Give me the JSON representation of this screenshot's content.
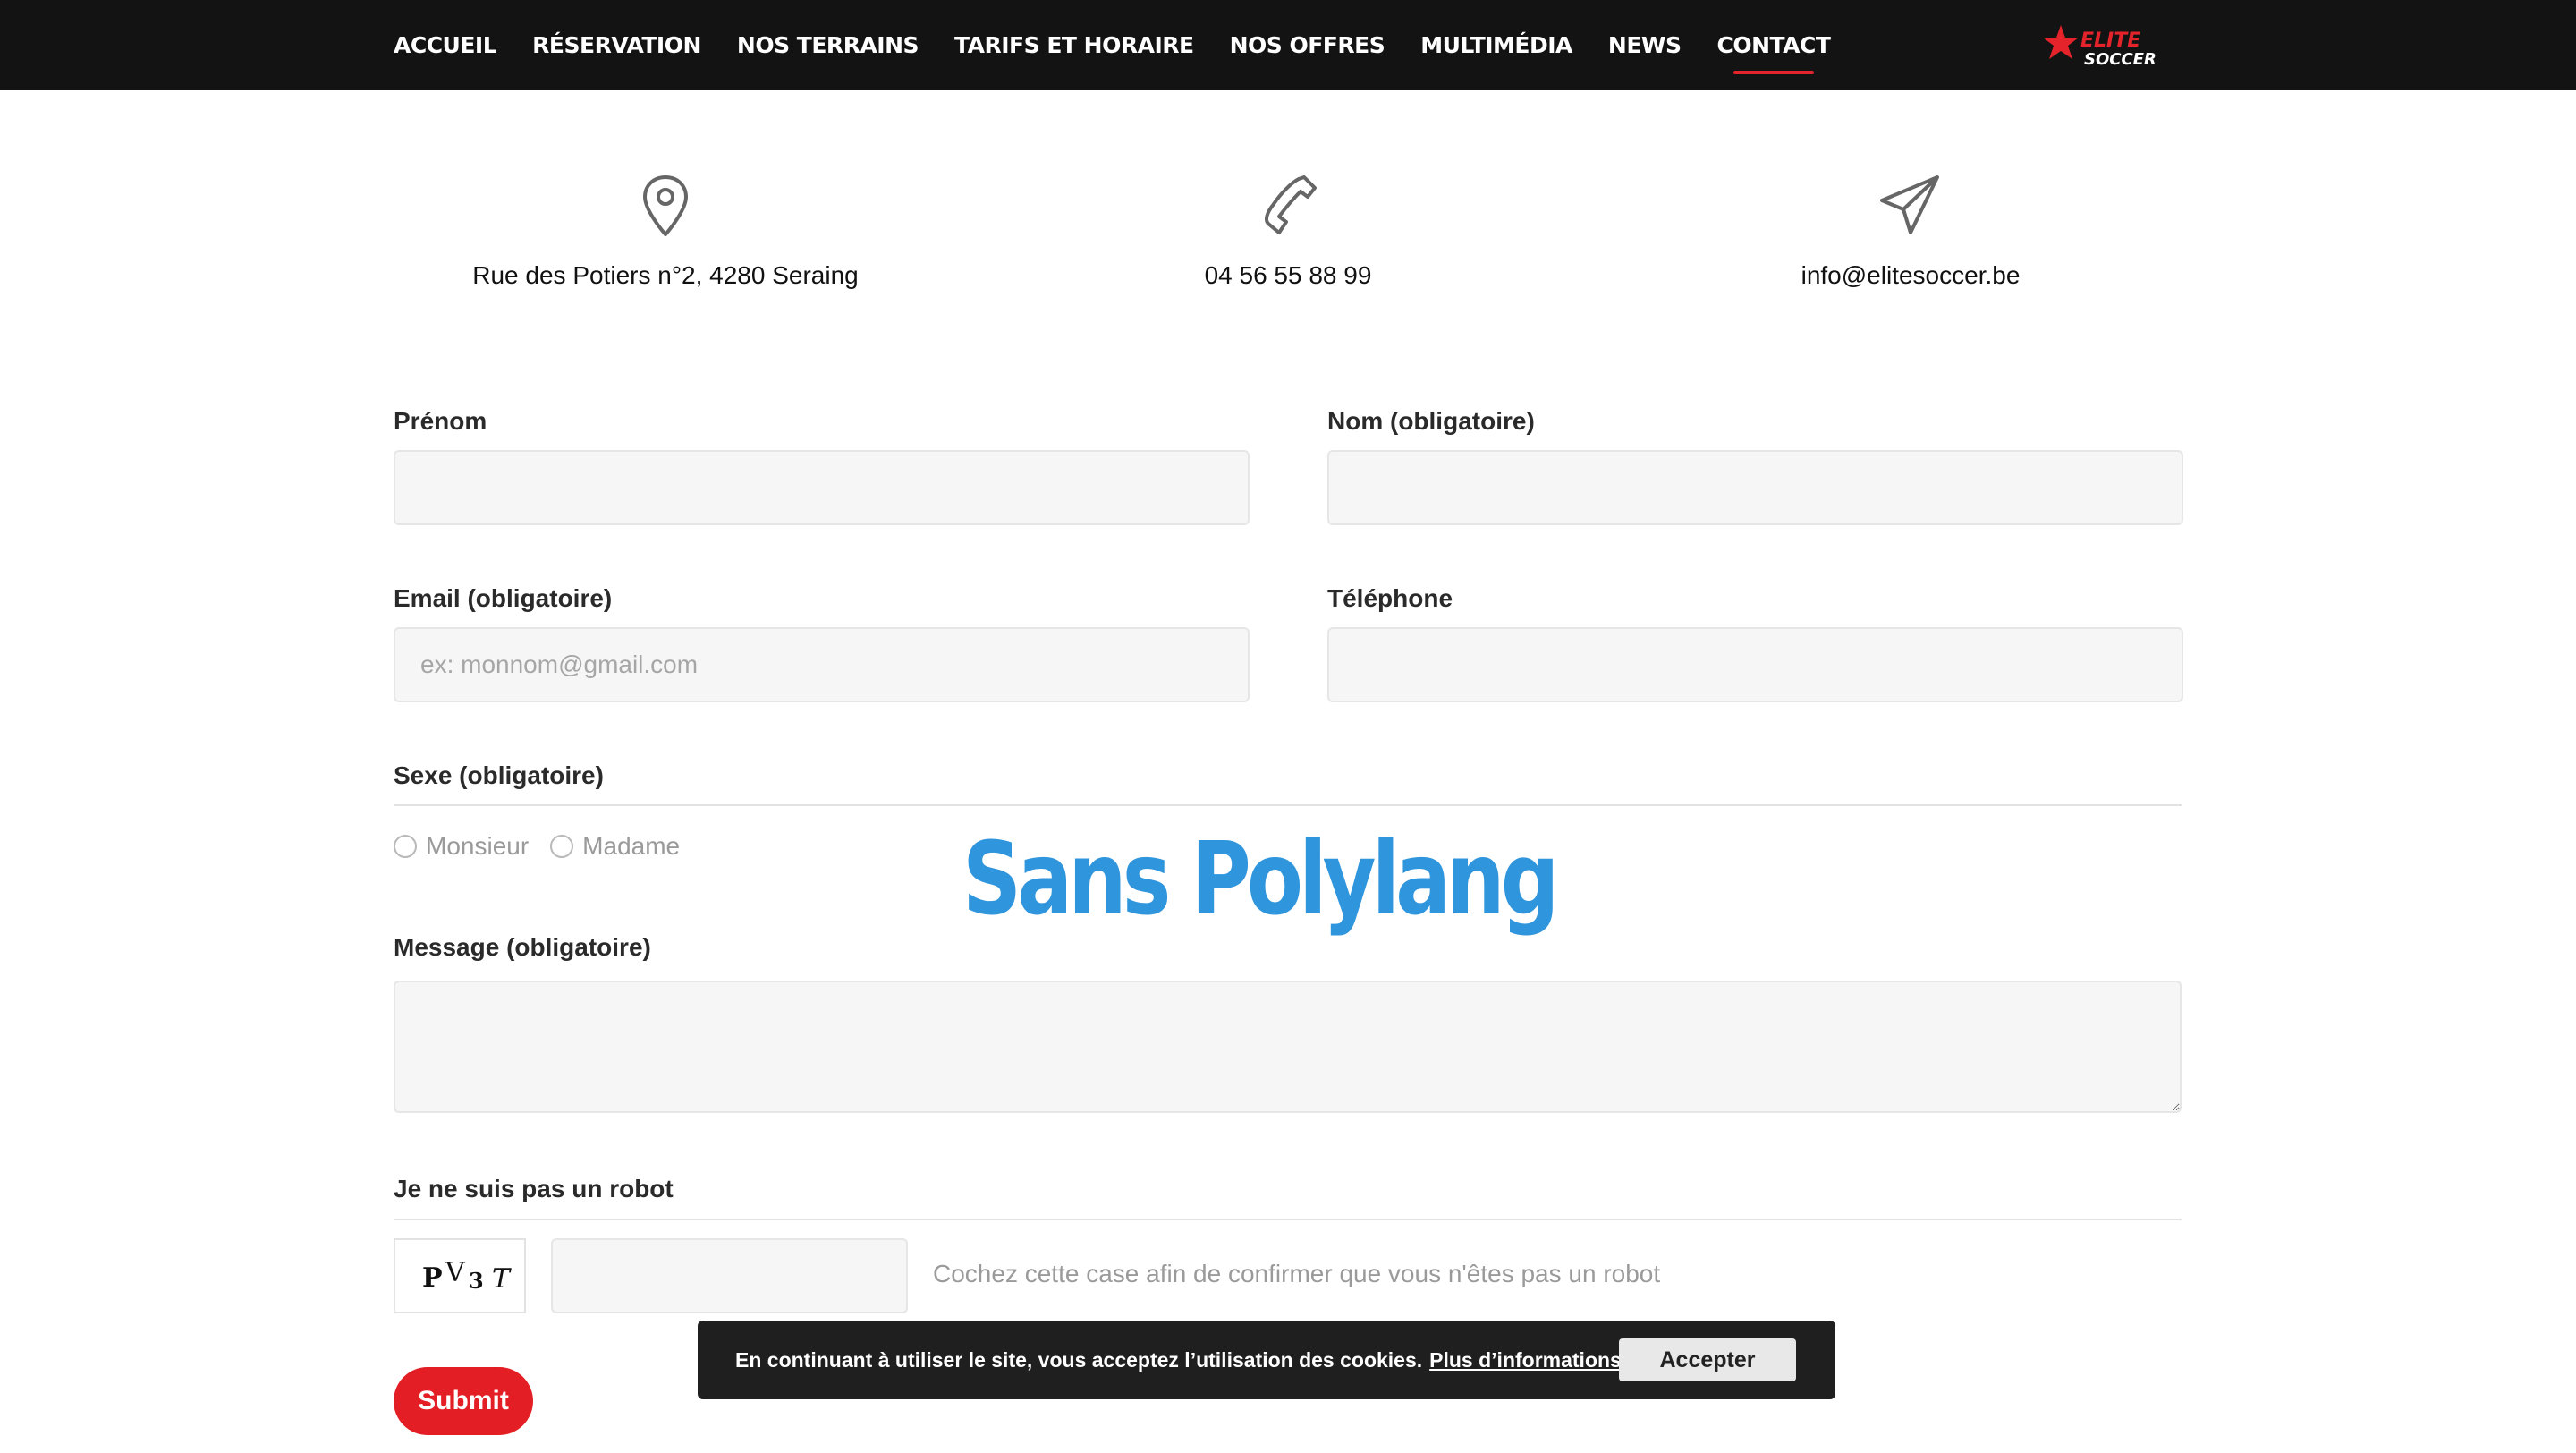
{
  "nav": {
    "items": [
      {
        "label": "ACCUEIL"
      },
      {
        "label": "RÉSERVATION"
      },
      {
        "label": "NOS TERRAINS"
      },
      {
        "label": "TARIFS ET HORAIRE"
      },
      {
        "label": "NOS OFFRES"
      },
      {
        "label": "MULTIMÉDIA"
      },
      {
        "label": "NEWS"
      },
      {
        "label": "CONTACT"
      }
    ],
    "active": "CONTACT",
    "logo": {
      "top": "ELITE",
      "bottom": "SOCCER",
      "accent": "#e4232b"
    }
  },
  "contact": {
    "address": "Rue des Potiers n°2, 4280 Seraing",
    "phone": "04 56 55 88 99",
    "email": "info@elitesoccer.be",
    "icons": [
      "map-pin-icon",
      "phone-icon",
      "paper-plane-icon"
    ]
  },
  "form": {
    "firstname_label": "Prénom",
    "firstname_value": "",
    "lastname_label": "Nom (obligatoire)",
    "lastname_value": "",
    "email_label": "Email (obligatoire)",
    "email_placeholder": "ex: monnom@gmail.com",
    "phone_label": "Téléphone",
    "phone_value": "",
    "gender_label": "Sexe (obligatoire)",
    "gender_options": [
      "Monsieur",
      "Madame"
    ],
    "message_label": "Message (obligatoire)",
    "message_value": "",
    "robot_label": "Je ne suis pas un robot",
    "captcha_code": "PV3T",
    "captcha_help": "Cochez cette case afin de confirmer que vous n'êtes pas un robot",
    "submit_label": "Submit"
  },
  "overlay_text": "Sans Polylang",
  "cookie": {
    "text": "En continuant à utiliser le site, vous acceptez l’utilisation des cookies.",
    "link": "Plus d’informations",
    "button": "Accepter"
  },
  "colors": {
    "nav_bg": "#131313",
    "accent": "#e31e25",
    "overlay": "#2f95dc",
    "field_bg": "#f6f6f6"
  }
}
